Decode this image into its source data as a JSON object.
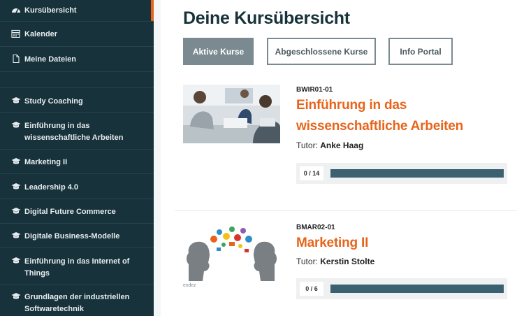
{
  "sidebar": {
    "items": [
      {
        "label": "Kursübersicht",
        "icon": "dashboard-icon",
        "active": true
      },
      {
        "label": "Kalender",
        "icon": "calendar-icon"
      },
      {
        "label": "Meine Dateien",
        "icon": "file-icon"
      },
      {
        "label": "Study Coaching",
        "icon": "graduation-cap-icon"
      },
      {
        "label": "Einführung in das wissenschaftliche Arbeiten",
        "icon": "graduation-cap-icon"
      },
      {
        "label": "Marketing II",
        "icon": "graduation-cap-icon"
      },
      {
        "label": "Leadership 4.0",
        "icon": "graduation-cap-icon"
      },
      {
        "label": "Digital Future Commerce",
        "icon": "graduation-cap-icon"
      },
      {
        "label": "Digitale Business-Modelle",
        "icon": "graduation-cap-icon"
      },
      {
        "label": "Einführung in das Internet of Things",
        "icon": "graduation-cap-icon"
      },
      {
        "label": "Grundlagen der industriellen Softwaretechnik",
        "icon": "graduation-cap-icon"
      }
    ]
  },
  "main": {
    "title": "Deine Kursübersicht",
    "tabs": [
      {
        "label": "Aktive Kurse",
        "active": true
      },
      {
        "label": "Abgeschlossene Kurse"
      },
      {
        "label": "Info Portal"
      }
    ],
    "courses": [
      {
        "code": "BWIR01-01",
        "title_line1": "Einführung in das",
        "title_line2": "wissenschaftliche Arbeiten",
        "tutor_label": "Tutor:",
        "tutor_name": "Anke Haag",
        "progress_text": "0 / 14",
        "progress": 0
      },
      {
        "code": "BMAR02-01",
        "title_line1": "Marketing II",
        "tutor_label": "Tutor:",
        "tutor_name": "Kerstin Stolte",
        "progress_text": "0 / 6",
        "progress": 0,
        "image_caption": "exdez"
      }
    ]
  },
  "colors": {
    "sidebar": "#17323b",
    "accent": "#e8641b",
    "tab_active": "#7b8a90",
    "progress_bar": "#3b6170"
  }
}
